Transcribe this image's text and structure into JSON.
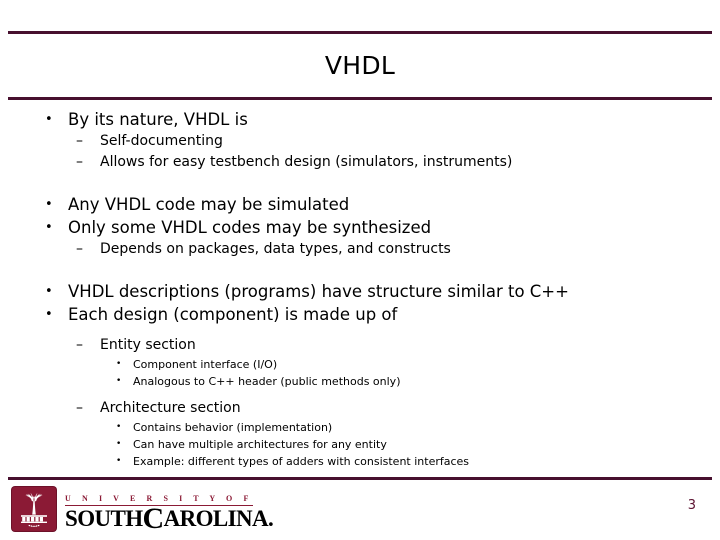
{
  "slide": {
    "title": "VHDL",
    "page_number": "3",
    "accent_color": "#47102F",
    "logo_color": "#8B1A35",
    "page_number_color": "#5B1130",
    "background_color": "#FFFFFF"
  },
  "marks": {
    "level1": "•",
    "level2": "–",
    "level3": "•"
  },
  "content": {
    "group1": {
      "lead": "By its nature, VHDL is",
      "subs": [
        "Self-documenting",
        "Allows for easy testbench design (simulators, instruments)"
      ]
    },
    "group2": {
      "lead1": "Any VHDL code may be simulated",
      "lead2": "Only some VHDL codes may be synthesized",
      "subs": [
        "Depends on packages, data types, and constructs"
      ]
    },
    "group3": {
      "lead1": "VHDL descriptions (programs) have structure similar to C++",
      "lead2": "Each design (component) is made up of",
      "entity": {
        "label": "Entity section",
        "items": [
          "Component interface (I/O)",
          "Analogous to C++ header (public methods only)"
        ]
      },
      "architecture": {
        "label": "Architecture section",
        "items": [
          "Contains behavior (implementation)",
          "Can have multiple architectures for any entity",
          "Example:  different types of adders with consistent interfaces"
        ]
      }
    }
  },
  "footer": {
    "logo_top_text": "U N I V E R S I T Y   O F",
    "logo_main_prefix": "SOUTH",
    "logo_main_c": "C",
    "logo_main_suffix": "AROLINA."
  }
}
